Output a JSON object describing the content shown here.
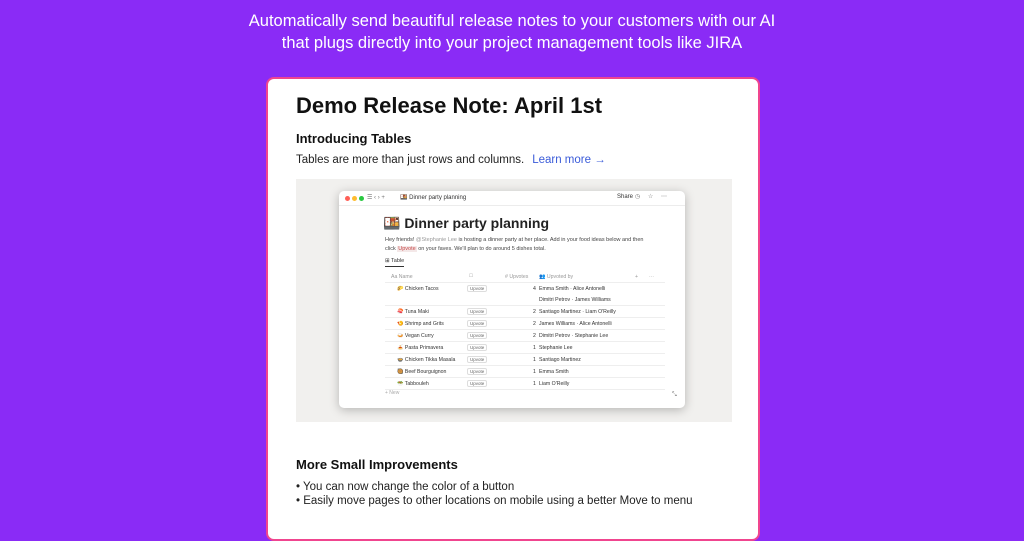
{
  "hero": {
    "line1": "Automatically send beautiful release notes to your customers with our AI",
    "line2": "that plugs directly into your project management tools like JIRA"
  },
  "note": {
    "title": "Demo Release Note: April 1st",
    "section1_heading": "Introducing Tables",
    "section1_text": "Tables are more than just rows and columns.",
    "learn_more": "Learn more →",
    "section2_heading": "More Small Improvements",
    "bullets": [
      "• You can now change the color of a button",
      "• Easily move pages to other locations on mobile using a better Move to menu"
    ]
  },
  "screenshot": {
    "nav": "☰  ‹  ›  +",
    "page_crumb": "🍱 Dinner party planning",
    "share": "Share",
    "toolbar_icons": "◷ ☆ ⋯",
    "title": "🍱 Dinner party planning",
    "intro_1": "Hey friends! ",
    "mention": "@Stephanie Lee",
    "intro_2": " is hosting a dinner party at her place. Add in your food ideas below and then click ",
    "code": "Upvote",
    "intro_3": " on your faves. We'll plan to do around 5 dishes total.",
    "view_tab": "⊞ Table",
    "headers": [
      "Aa Name",
      "☐",
      "# Upvotes",
      "👥 Upvoted by",
      "+",
      "⋯"
    ],
    "rows": [
      {
        "name": "🌮 Chicken Tacos",
        "button": "Upvote",
        "count": "4",
        "voters": "Emma Smith  ·  Alice Antonelli",
        "voters2": "Dimitri Petrov  ·  James Williams"
      },
      {
        "name": "🍣 Tuna Maki",
        "button": "Upvote",
        "count": "2",
        "voters": "Santiago Martinez  ·  Liam O'Reilly"
      },
      {
        "name": "🍤 Shrimp and Grits",
        "button": "Upvote",
        "count": "2",
        "voters": "James Williams  ·  Alice Antonelli"
      },
      {
        "name": "🍛 Vegan Curry",
        "button": "Upvote",
        "count": "2",
        "voters": "Dimitri Petrov  ·  Stephanie Lee"
      },
      {
        "name": "🍝 Pasta Primavera",
        "button": "Upvote",
        "count": "1",
        "voters": "Stephanie Lee"
      },
      {
        "name": "🍲 Chicken Tikka Masala",
        "button": "Upvote",
        "count": "1",
        "voters": "Santiago Martinez"
      },
      {
        "name": "🥘 Beef Bourguignon",
        "button": "Upvote",
        "count": "1",
        "voters": "Emma Smith"
      },
      {
        "name": "🥗 Tabbouleh",
        "button": "Upvote",
        "count": "1",
        "voters": "Liam O'Reilly"
      }
    ],
    "new_row": "+ New",
    "expand": "⤡"
  },
  "colors": {
    "background": "#8a2bf6",
    "card_border": "#f0458f",
    "link": "#3a5bd9"
  }
}
